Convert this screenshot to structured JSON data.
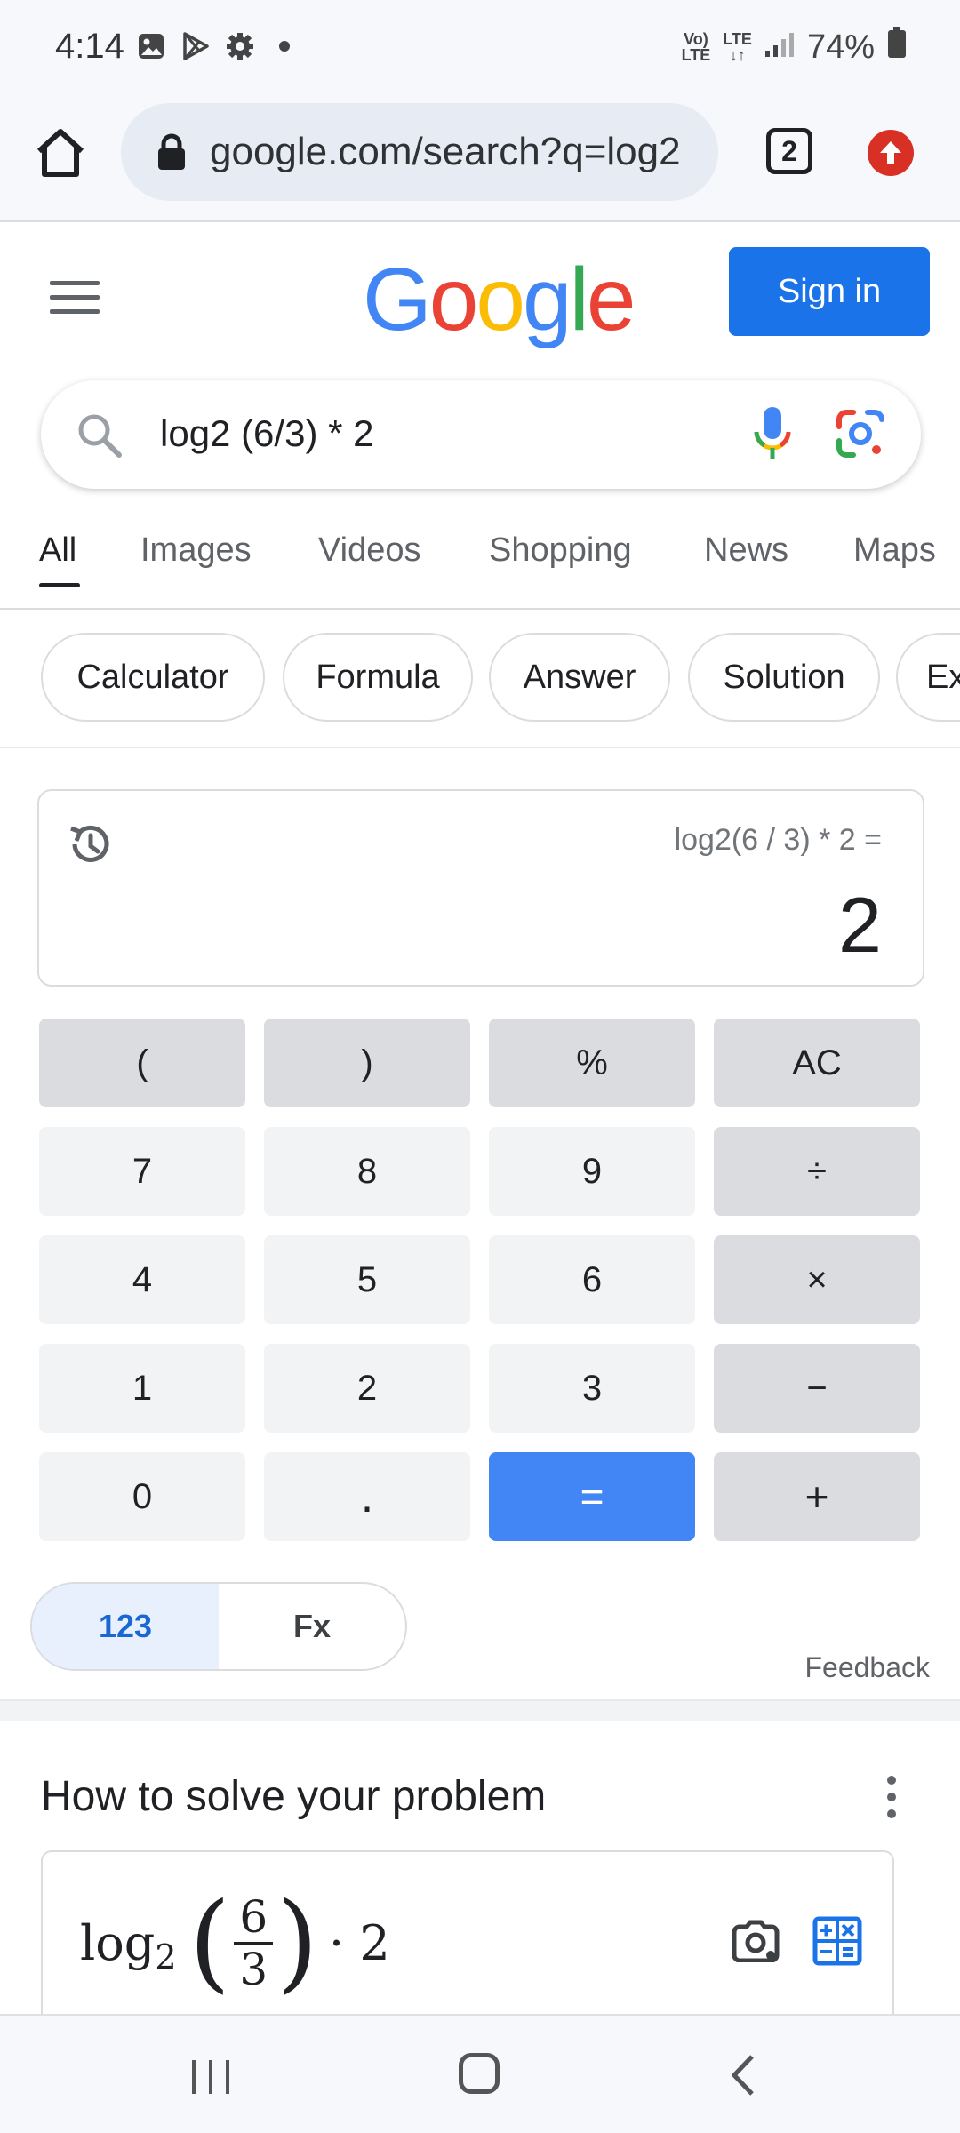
{
  "status_bar": {
    "time": "4:14",
    "battery": "74%",
    "volte_top": "Vo)",
    "volte_bottom": "LTE",
    "lte_top": "LTE",
    "lte_bottom": "↓↑",
    "icons": [
      "gallery-icon",
      "play-store-icon",
      "settings-icon",
      "dot-icon",
      "signal-icon",
      "battery-icon"
    ]
  },
  "browser": {
    "url": "google.com/search?q=log2",
    "tab_count": "2"
  },
  "header": {
    "logo_letters": [
      "G",
      "o",
      "o",
      "g",
      "l",
      "e"
    ],
    "logo_colors": [
      "#4285f4",
      "#ea4335",
      "#fbbc05",
      "#4285f4",
      "#34a853",
      "#ea4335"
    ],
    "signin_label": "Sign in"
  },
  "search": {
    "query": "log2 (6/3) * 2"
  },
  "tabs": [
    "All",
    "Images",
    "Videos",
    "Shopping",
    "News",
    "Maps"
  ],
  "chips": [
    "Calculator",
    "Formula",
    "Answer",
    "Solution",
    "Ex"
  ],
  "calculator": {
    "expression": "log2(6 / 3) * 2 =",
    "result": "2",
    "keys": [
      [
        "(",
        ")",
        "%",
        "AC"
      ],
      [
        "7",
        "8",
        "9",
        "÷"
      ],
      [
        "4",
        "5",
        "6",
        "×"
      ],
      [
        "1",
        "2",
        "3",
        "−"
      ],
      [
        "0",
        ".",
        "=",
        "+"
      ]
    ],
    "mode_basic": "123",
    "mode_fx": "Fx",
    "feedback": "Feedback"
  },
  "solve": {
    "title": "How to solve your problem",
    "math_log": "log",
    "math_base": "2",
    "math_num": "6",
    "math_den": "3",
    "math_tail": "· 2"
  },
  "colors": {
    "accent": "#1a73e8",
    "equals_key": "#4285f4",
    "update_badge": "#d93025"
  }
}
